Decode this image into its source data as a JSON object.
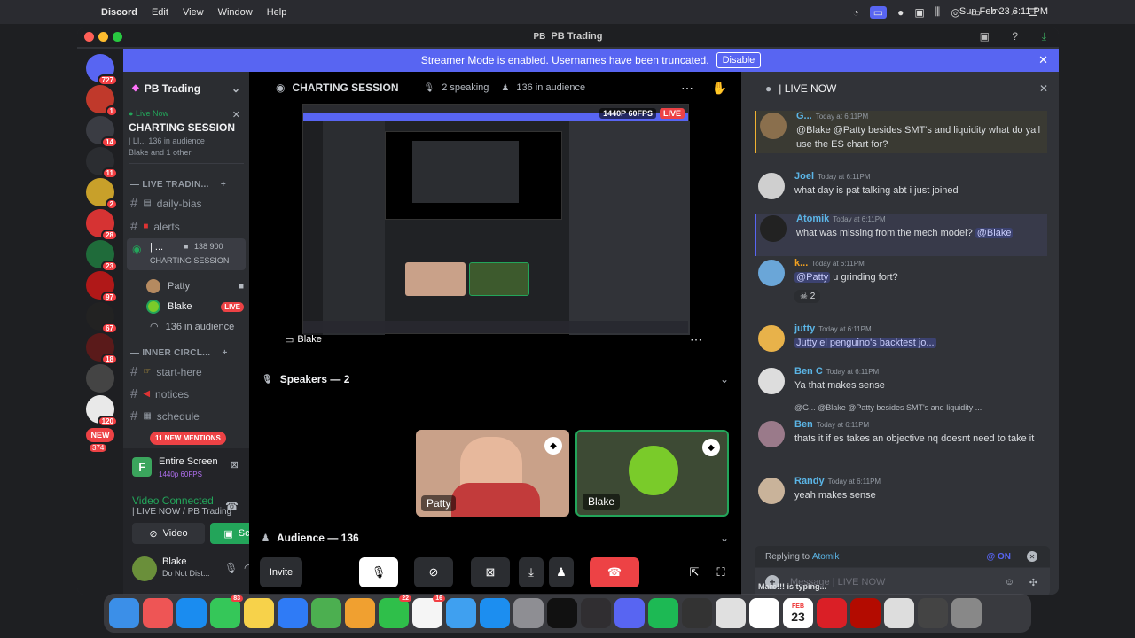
{
  "menubar": {
    "app": "Discord",
    "items": [
      "Edit",
      "View",
      "Window",
      "Help"
    ],
    "clock": "Sun Feb 23  6:11 PM"
  },
  "window": {
    "title": "PB Trading"
  },
  "banner": {
    "text": "Streamer Mode is enabled. Usernames have been truncated.",
    "disable": "Disable"
  },
  "rail": {
    "servers": [
      {
        "label": "727",
        "color": "#5865f2"
      },
      {
        "label": "1",
        "color": "#c0392b"
      },
      {
        "label": "14",
        "color": "#3a3c43"
      },
      {
        "label": "11",
        "color": "#2b2d31"
      },
      {
        "label": "2",
        "color": "#c8a02a"
      },
      {
        "label": "28",
        "color": "#d63333"
      },
      {
        "label": "23",
        "color": "#1f6b3a"
      },
      {
        "label": "97",
        "color": "#b01818"
      },
      {
        "label": "67",
        "color": "#222"
      },
      {
        "label": "18",
        "color": "#5a1a1a"
      },
      {
        "label": "",
        "color": "#444"
      },
      {
        "label": "120",
        "color": "#e9e9e9"
      }
    ],
    "new_label": "NEW",
    "new_count": "374"
  },
  "sidebar": {
    "guild": "PB Trading",
    "live_now_tag": "Live Now",
    "session_title": "CHARTING SESSION",
    "session_sub": "| LI...  136 in audience",
    "session_users": "Blake and 1 other",
    "cat1": "LIVE TRADIN...",
    "ch_daily": "daily-bias",
    "ch_alerts": "alerts",
    "voice_name": "| ...",
    "voice_stats": "138  900",
    "voice_sub": "CHARTING SESSION",
    "patty": "Patty",
    "blake": "Blake",
    "live_badge": "LIVE",
    "audience": "136 in audience",
    "cat2": "INNER CIRCL...",
    "ch_start": "start-here",
    "ch_notices": "notices",
    "ch_schedule": "schedule",
    "mentions": "11 NEW MENTIONS"
  },
  "userpanel": {
    "screen_title": "Entire Screen",
    "screen_quality": "1440p 60FPS",
    "video_connected": "Video Connected",
    "video_sub": "| LIVE NOW / PB Trading",
    "video_btn": "Video",
    "screen_btn": "Screen",
    "user": "Blake",
    "status": "Do Not Dist..."
  },
  "stage": {
    "title": "CHARTING SESSION",
    "speaking": "2 speaking",
    "audience": "136 in audience",
    "quality": "1440P 60FPS",
    "live": "LIVE",
    "streamer": "Blake",
    "speakers_header": "Speakers — 2",
    "tile1": "Patty",
    "tile2": "Blake",
    "audience_header": "Audience — 136",
    "invite": "Invite"
  },
  "chat": {
    "title": "| LIVE NOW",
    "messages": [
      {
        "name": "G...",
        "color": "#5bb5e6",
        "time": "Today at 6:11PM",
        "text": "@Blake @Patty besides SMT's and liquidity what do yall use the ES chart for?"
      },
      {
        "name": "Joel",
        "color": "#5bb5e6",
        "time": "Today at 6:11PM",
        "text": "what day is pat talking abt i just joined"
      },
      {
        "name": "Atomik",
        "color": "#5bb5e6",
        "time": "Today at 6:11PM",
        "text": "what was missing from the mech model?",
        "mention": "@Blake"
      },
      {
        "name": "k...",
        "color": "#f0a020",
        "time": "Today at 6:11PM",
        "text": "u grinding fort?",
        "mention_pre": "@Patty",
        "reaction": "2"
      },
      {
        "name": "jutty",
        "color": "#5bb5e6",
        "time": "Today at 6:11PM",
        "text": "Jutty el penguino's backtest jo..."
      },
      {
        "name": "Ben C",
        "color": "#5bb5e6",
        "time": "Today at 6:11PM",
        "text": "Ya that makes sense"
      },
      {
        "name": "Ben",
        "color": "#5bb5e6",
        "time": "Today at 6:11PM",
        "reply": "@G... @Blake @Patty besides SMT's and liquidity ...",
        "text": "thats it if es takes an objective nq doesnt need to take it"
      },
      {
        "name": "Randy",
        "color": "#5bb5e6",
        "time": "Today at 6:11PM",
        "text": "yeah makes sense"
      }
    ],
    "replying_to": "Replying to",
    "reply_target": "Atomik",
    "reply_on": "@ ON",
    "placeholder": "Message  | LIVE NOW",
    "typing": "Marc!!! is typing..."
  },
  "dock": {
    "apps": [
      {
        "name": "finder",
        "color": "#3b8fe8",
        "badge": ""
      },
      {
        "name": "launchpad",
        "color": "#e55",
        "badge": ""
      },
      {
        "name": "safari",
        "color": "#1a8cf0",
        "badge": ""
      },
      {
        "name": "messages",
        "color": "#35c759",
        "badge": "83"
      },
      {
        "name": "notes",
        "color": "#f7d24a",
        "badge": ""
      },
      {
        "name": "mail",
        "color": "#2f7bf6",
        "badge": ""
      },
      {
        "name": "maps",
        "color": "#4caf50",
        "badge": ""
      },
      {
        "name": "photos",
        "color": "#f0a030",
        "badge": ""
      },
      {
        "name": "facetime",
        "color": "#2fbf4a",
        "badge": "22"
      },
      {
        "name": "reminders",
        "color": "#f5f5f5",
        "badge": "16"
      },
      {
        "name": "weather",
        "color": "#3fa0f0",
        "badge": ""
      },
      {
        "name": "app-store",
        "color": "#1c8ef0",
        "badge": ""
      },
      {
        "name": "settings",
        "color": "#8e8e93",
        "badge": ""
      },
      {
        "name": "tradingview",
        "color": "#111",
        "badge": ""
      },
      {
        "name": "obs",
        "color": "#302e31",
        "badge": ""
      },
      {
        "name": "discord",
        "color": "#5865f2",
        "badge": ""
      },
      {
        "name": "spotify",
        "color": "#1db954",
        "badge": ""
      },
      {
        "name": "quicktime",
        "color": "#333",
        "badge": ""
      },
      {
        "name": "chrome",
        "color": "#e0e0e0",
        "badge": ""
      },
      {
        "name": "slack",
        "color": "#fff",
        "badge": ""
      },
      {
        "name": "calendar",
        "color": "#fff",
        "badge": ""
      },
      {
        "name": "creative-cloud",
        "color": "#da1f26",
        "badge": ""
      },
      {
        "name": "acrobat",
        "color": "#b30b00",
        "badge": ""
      },
      {
        "name": "downloads",
        "color": "#ddd",
        "badge": ""
      },
      {
        "name": "help",
        "color": "#444",
        "badge": ""
      },
      {
        "name": "trash",
        "color": "#888",
        "badge": ""
      }
    ],
    "calendar_month": "FEB",
    "calendar_day": "23"
  }
}
